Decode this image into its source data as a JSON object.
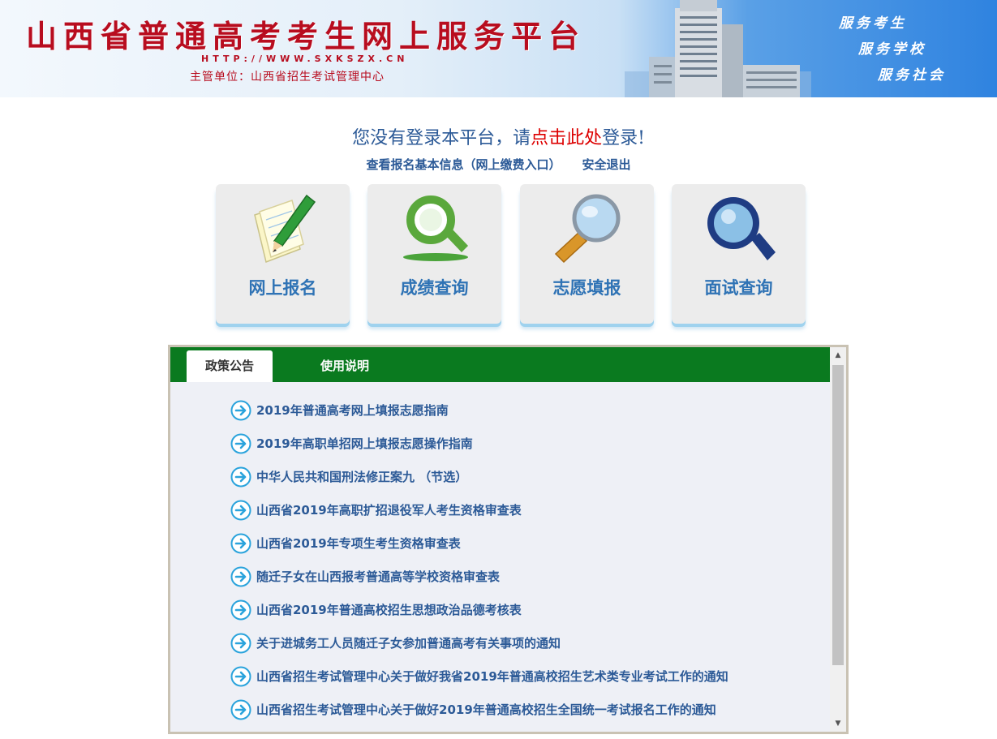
{
  "header": {
    "title": "山西省普通高考考生网上服务平台",
    "url": "HTTP://WWW.SXKSZX.CN",
    "organizer": "主管单位：山西省招生考试管理中心",
    "slogans": [
      "服务考生",
      "服务学校",
      "服务社会"
    ]
  },
  "login": {
    "prefix": "您没有登录本平台，请",
    "link_label": "点击此处",
    "suffix": "登录!"
  },
  "links": {
    "basic_info": "查看报名基本信息（网上缴费入口）",
    "logout": "安全退出"
  },
  "tiles": [
    {
      "label": "网上报名",
      "icon": "pen-paper-icon"
    },
    {
      "label": "成绩查询",
      "icon": "magnifier-green-icon"
    },
    {
      "label": "志愿填报",
      "icon": "magnifier-gold-icon"
    },
    {
      "label": "面试查询",
      "icon": "magnifier-navy-icon"
    }
  ],
  "tabs": {
    "active": "政策公告",
    "inactive": "使用说明"
  },
  "notices": [
    "2019年普通高考网上填报志愿指南",
    "2019年高职单招网上填报志愿操作指南",
    "中华人民共和国刑法修正案九 （节选）",
    "山西省2019年高职扩招退役军人考生资格审查表",
    "山西省2019年专项生考生资格审查表",
    "随迁子女在山西报考普通高等学校资格审查表",
    "山西省2019年普通高校招生思想政治品德考核表",
    "关于进城务工人员随迁子女参加普通高考有关事项的通知",
    "山西省招生考试管理中心关于做好我省2019年普通高校招生艺术类专业考试工作的通知",
    "山西省招生考试管理中心关于做好2019年普通高校招生全国统一考试报名工作的通知"
  ],
  "colors": {
    "brand_red": "#b80d1f",
    "link_blue": "#2c5a97",
    "tab_green": "#0a7a1f"
  }
}
